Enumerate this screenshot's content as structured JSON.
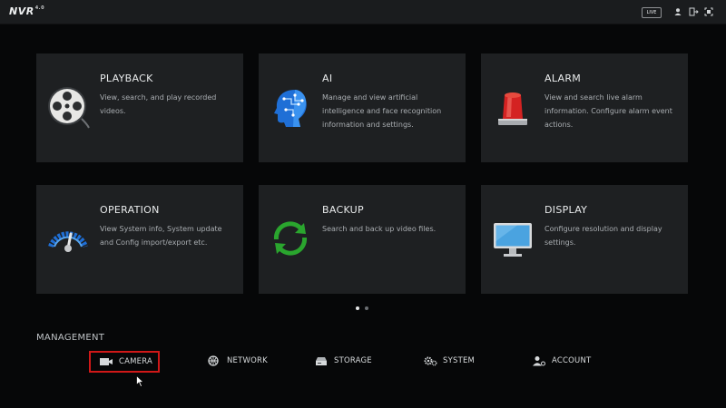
{
  "topbar": {
    "logo": "NVR",
    "version": "4.0",
    "live_label": "LIVE",
    "icons": [
      "user-icon",
      "logout-icon",
      "fullscreen-icon"
    ]
  },
  "tiles": [
    {
      "title": "PLAYBACK",
      "desc": "View, search, and play recorded videos.",
      "icon": "film-reel-icon"
    },
    {
      "title": "AI",
      "desc": "Manage and view artificial intelligence and face recognition information and settings.",
      "icon": "ai-head-icon"
    },
    {
      "title": "ALARM",
      "desc": "View and search live alarm information. Configure alarm event actions.",
      "icon": "alarm-siren-icon"
    },
    {
      "title": "OPERATION",
      "desc": "View System info, System update and Config import/export etc.",
      "icon": "gauge-icon"
    },
    {
      "title": "BACKUP",
      "desc": "Search and back up video files.",
      "icon": "sync-arrows-icon"
    },
    {
      "title": "DISPLAY",
      "desc": "Configure resolution and display settings.",
      "icon": "monitor-icon"
    }
  ],
  "pager": {
    "pages": 2,
    "active": 1
  },
  "management": {
    "title": "MANAGEMENT",
    "items": [
      {
        "label": "CAMERA",
        "icon": "camera-icon",
        "selected": true
      },
      {
        "label": "NETWORK",
        "icon": "network-globe-icon"
      },
      {
        "label": "STORAGE",
        "icon": "storage-disk-icon"
      },
      {
        "label": "SYSTEM",
        "icon": "system-gears-icon"
      },
      {
        "label": "ACCOUNT",
        "icon": "account-icon"
      }
    ]
  },
  "colors": {
    "background": "#060708",
    "tile": "#1e2022",
    "highlight": "#d01818",
    "backup_green": "#2aa52e",
    "alarm_red": "#d42222"
  }
}
